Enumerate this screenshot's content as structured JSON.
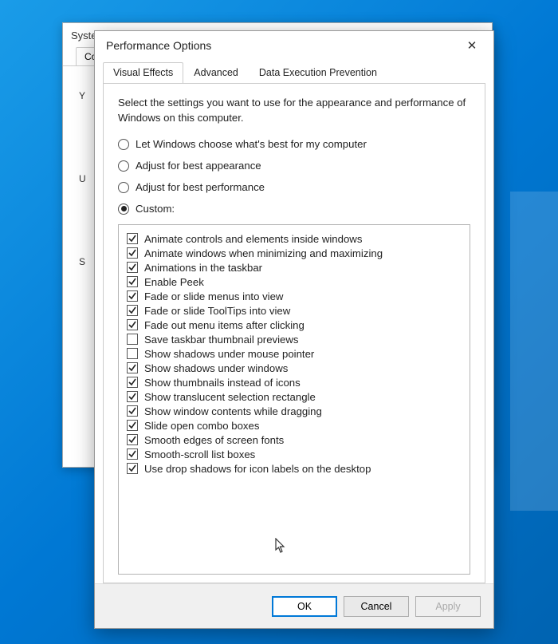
{
  "back_window": {
    "title_prefix": "Syste",
    "tab_label_prefix": "Com",
    "frag1": "Y",
    "frag2": "U",
    "frag3": "S"
  },
  "dialog": {
    "title": "Performance Options",
    "tabs": [
      {
        "label": "Visual Effects",
        "active": true
      },
      {
        "label": "Advanced",
        "active": false
      },
      {
        "label": "Data Execution Prevention",
        "active": false
      }
    ],
    "intro": "Select the settings you want to use for the appearance and performance of Windows on this computer.",
    "radios": [
      {
        "label": "Let Windows choose what's best for my computer",
        "checked": false
      },
      {
        "label": "Adjust for best appearance",
        "checked": false
      },
      {
        "label": "Adjust for best performance",
        "checked": false
      },
      {
        "label": "Custom:",
        "checked": true
      }
    ],
    "checkboxes": [
      {
        "label": "Animate controls and elements inside windows",
        "checked": true
      },
      {
        "label": "Animate windows when minimizing and maximizing",
        "checked": true
      },
      {
        "label": "Animations in the taskbar",
        "checked": true
      },
      {
        "label": "Enable Peek",
        "checked": true
      },
      {
        "label": "Fade or slide menus into view",
        "checked": true
      },
      {
        "label": "Fade or slide ToolTips into view",
        "checked": true
      },
      {
        "label": "Fade out menu items after clicking",
        "checked": true
      },
      {
        "label": "Save taskbar thumbnail previews",
        "checked": false
      },
      {
        "label": "Show shadows under mouse pointer",
        "checked": false
      },
      {
        "label": "Show shadows under windows",
        "checked": true
      },
      {
        "label": "Show thumbnails instead of icons",
        "checked": true
      },
      {
        "label": "Show translucent selection rectangle",
        "checked": true
      },
      {
        "label": "Show window contents while dragging",
        "checked": true
      },
      {
        "label": "Slide open combo boxes",
        "checked": true
      },
      {
        "label": "Smooth edges of screen fonts",
        "checked": true
      },
      {
        "label": "Smooth-scroll list boxes",
        "checked": true
      },
      {
        "label": "Use drop shadows for icon labels on the desktop",
        "checked": true
      }
    ],
    "buttons": {
      "ok": "OK",
      "cancel": "Cancel",
      "apply": "Apply"
    }
  }
}
